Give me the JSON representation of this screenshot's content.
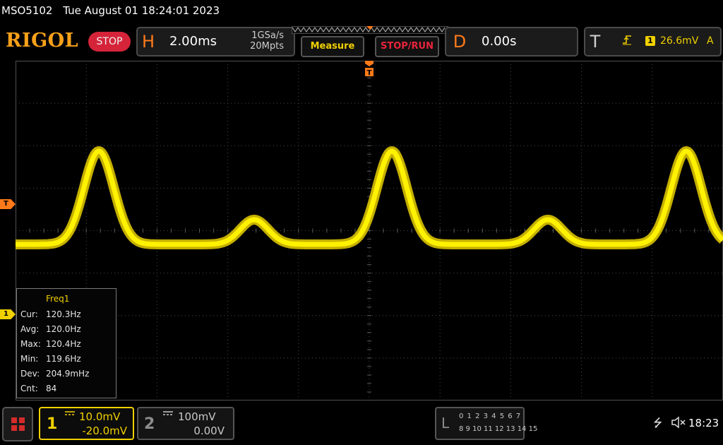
{
  "header": {
    "model": "MSO5102",
    "datetime": "Tue August 01 18:24:01 2023",
    "brand": "RIGOL",
    "run_state": "STOP"
  },
  "horizontal": {
    "letter": "H",
    "timebase": "2.00ms",
    "sample_rate": "1GSa/s",
    "memory_depth": "20Mpts"
  },
  "buttons": {
    "measure": "Measure",
    "stop_run": "STOP/RUN"
  },
  "delay": {
    "letter": "D",
    "value": "0.00s"
  },
  "trigger": {
    "letter": "T",
    "slope_icon": "rising-edge-icon",
    "source": "1",
    "level": "26.6mV",
    "coupling": "A"
  },
  "markers": {
    "trigger_level": "T",
    "channel1": "1",
    "trigger_position": "T"
  },
  "measurement": {
    "title": "Freq1",
    "rows": [
      {
        "label": "Cur:",
        "value": "120.3Hz"
      },
      {
        "label": "Avg:",
        "value": "120.0Hz"
      },
      {
        "label": "Max:",
        "value": "120.4Hz"
      },
      {
        "label": "Min:",
        "value": "119.6Hz"
      },
      {
        "label": "Dev:",
        "value": "204.9mHz"
      },
      {
        "label": "Cnt:",
        "value": "84"
      }
    ]
  },
  "channels": {
    "ch1": {
      "number": "1",
      "coupling_icon": "dc-coupling-icon",
      "scale": "10.0mV",
      "offset": "-20.0mV",
      "color": "#f0d000"
    },
    "ch2": {
      "number": "2",
      "coupling_icon": "dc-coupling-icon",
      "scale": "100mV",
      "offset": "0.00V",
      "color": "#8c8c8c"
    }
  },
  "logic": {
    "letter": "L",
    "row1": "0 1 2 3  4 5 6 7",
    "row2": "8 9 10 11 12 13 14 15"
  },
  "status": {
    "clock": "18:23",
    "usb_icon": "usb-icon",
    "speaker_icon": "speaker-muted-icon"
  },
  "colors": {
    "trace": "#f0d000",
    "accent": "#ff7a1a",
    "stop": "#d5243a"
  }
}
